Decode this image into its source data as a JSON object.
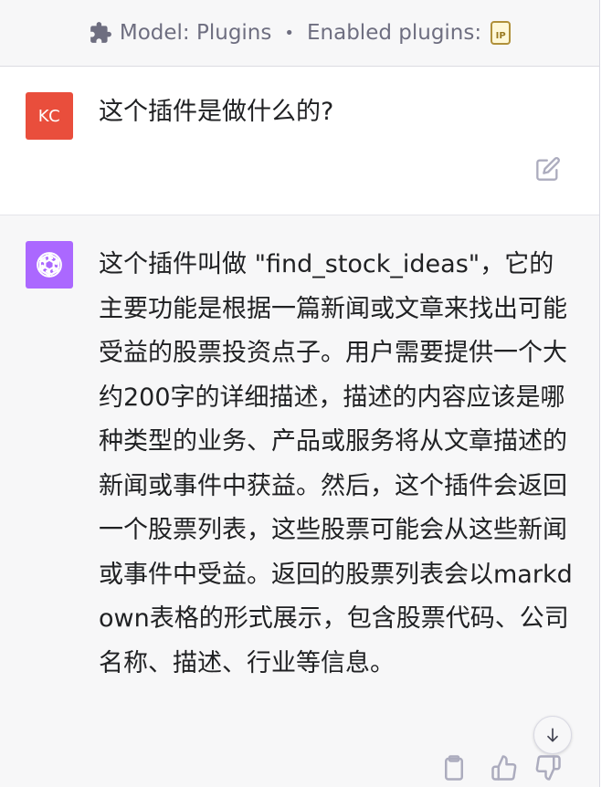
{
  "header": {
    "model_text": "Model: Plugins",
    "separator": "•",
    "enabled_text": "Enabled plugins:",
    "plugin_badge": "IP"
  },
  "user_message": {
    "avatar_initials": "KC",
    "avatar_color": "#e94e3c",
    "text": "这个插件是做什么的?"
  },
  "assistant_message": {
    "avatar_color": "#ab68ff",
    "text": "这个插件叫做 \"find_stock_ideas\"，它的主要功能是根据一篇新闻或文章来找出可能受益的股票投资点子。用户需要提供一个大约200字的详细描述，描述的内容应该是哪种类型的业务、产品或服务将从文章描述的新闻或事件中获益。然后，这个插件会返回一个股票列表，这些股票可能会从这些新闻或事件中受益。返回的股票列表会以markdown表格的形式展示，包含股票代码、公司名称、描述、行业等信息。"
  },
  "icons": [
    "puzzle-icon",
    "plugin-icon",
    "edit-icon",
    "openai-logo-icon",
    "arrow-down-icon",
    "clipboard-icon",
    "thumbs-up-icon",
    "thumbs-down-icon"
  ]
}
